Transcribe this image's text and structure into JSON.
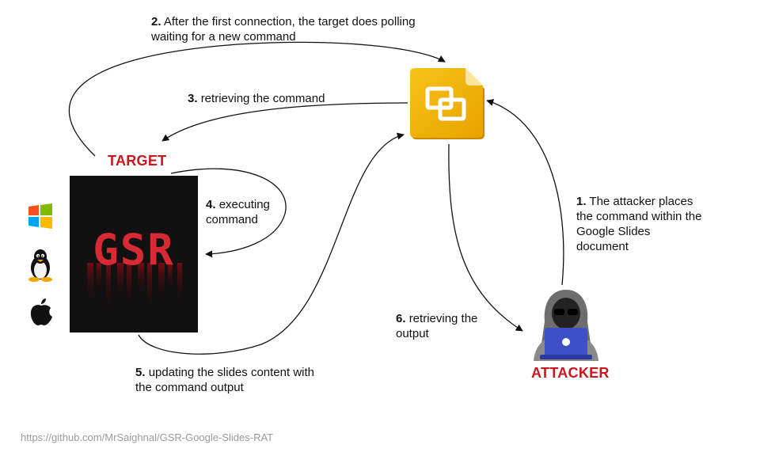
{
  "labels": {
    "target": "TARGET",
    "attacker": "ATTACKER",
    "gsr_logo_text": "GSR"
  },
  "steps": [
    {
      "num": "1.",
      "text": "The attacker places\nthe command within the\nGoogle Slides\ndocument"
    },
    {
      "num": "2.",
      "text": "After the first connection, the target does polling\nwaiting for a new command"
    },
    {
      "num": "3.",
      "text": "retrieving the command"
    },
    {
      "num": "4.",
      "text": "executing\ncommand"
    },
    {
      "num": "5.",
      "text": "updating the slides content with\nthe command output"
    },
    {
      "num": "6.",
      "text": "retrieving the\noutput"
    }
  ],
  "footer": "https://github.com/MrSaighnal/GSR-Google-Slides-RAT",
  "icons": {
    "os": [
      "windows-icon",
      "linux-icon",
      "apple-icon"
    ],
    "slides": "google-slides-icon",
    "attacker": "hacker-icon"
  },
  "colors": {
    "title_red": "#c8181e",
    "slides_yellow": "#f5b400",
    "laptop_blue": "#3e4fc8"
  }
}
